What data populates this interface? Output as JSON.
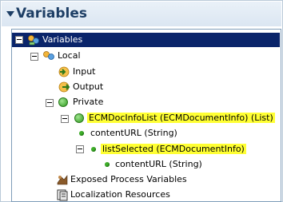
{
  "header": {
    "title": "Variables"
  },
  "tree": {
    "root": "Variables",
    "local": "Local",
    "input": "Input",
    "output": "Output",
    "private": "Private",
    "list_item": "ECMDocInfoList (ECMDocumentInfo) (List)",
    "list_child": "contentURL (String)",
    "selected_item": "listSelected (ECMDocumentInfo)",
    "selected_child": "contentURL (String)",
    "exposed": "Exposed Process Variables",
    "localization": "Localization Resources"
  },
  "colors": {
    "highlight": "#ffff33",
    "selection": "#0a246a",
    "header_text": "#1d3e65"
  }
}
